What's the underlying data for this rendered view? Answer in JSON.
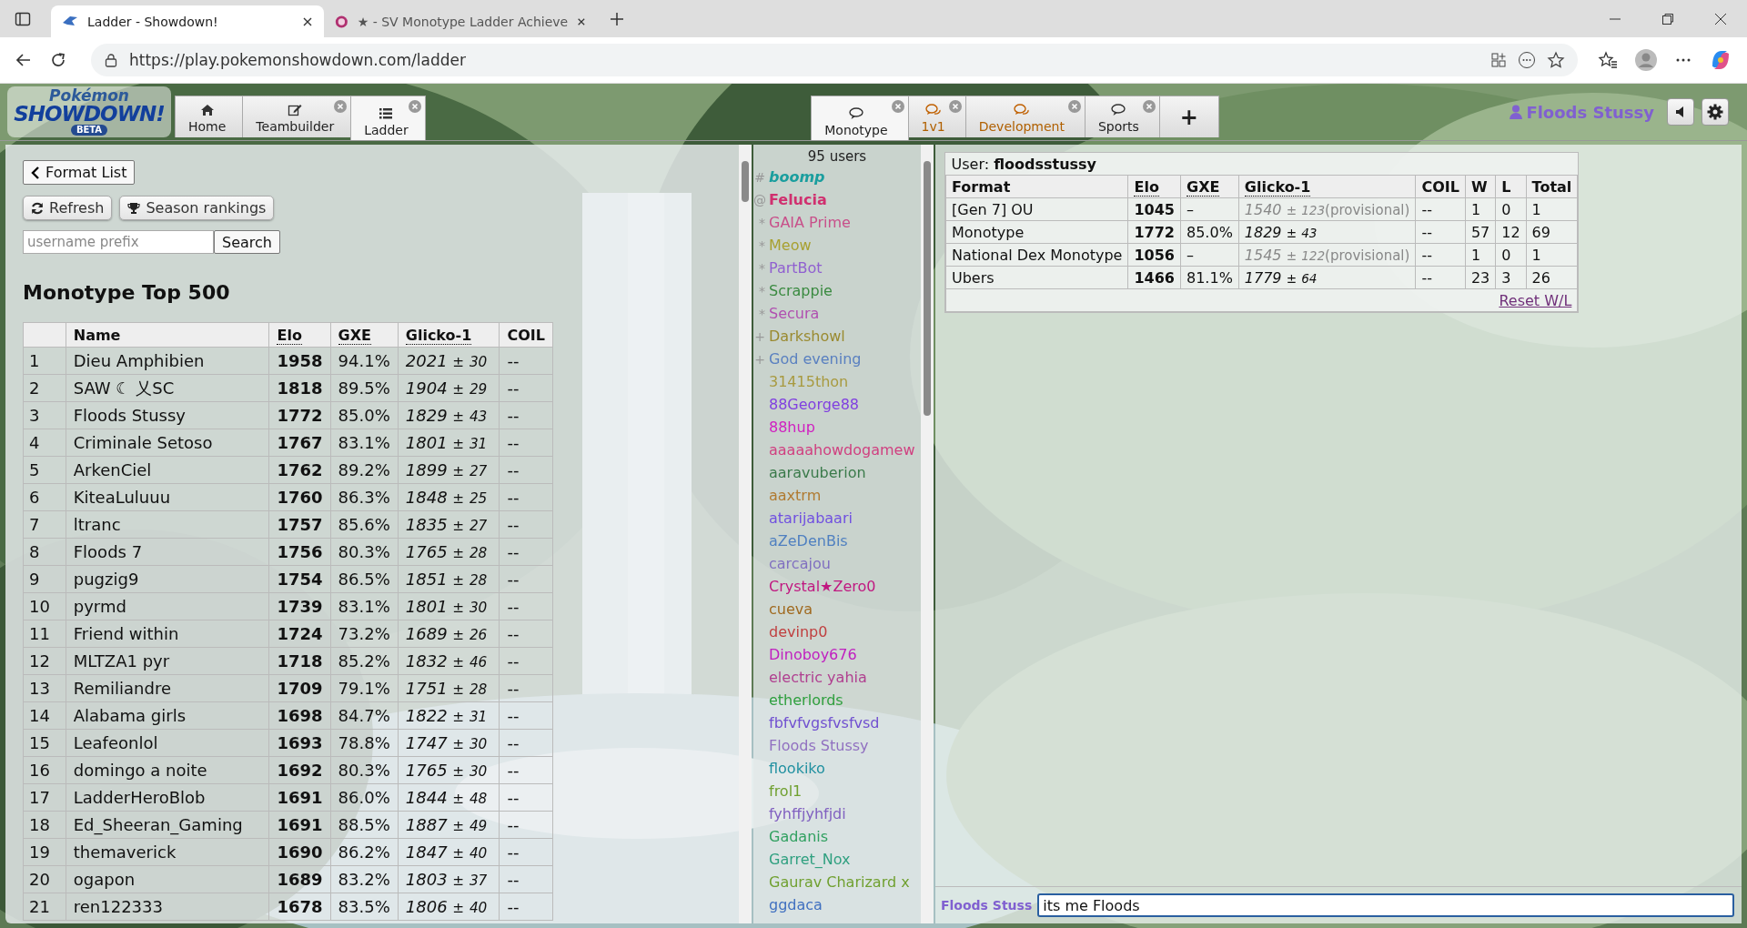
{
  "browser": {
    "tabs": [
      {
        "title": "Ladder - Showdown!",
        "selected": true
      },
      {
        "title": "★ - SV Monotype Ladder Achieve",
        "selected": false
      }
    ],
    "url": "https://play.pokemonshowdown.com/ladder"
  },
  "header": {
    "logo": {
      "top": "Pokémon",
      "main": "SHOWDOWN!",
      "badge": "BETA"
    },
    "nav_tabs": [
      {
        "label": "Home",
        "closable": false,
        "selected": false
      },
      {
        "label": "Teambuilder",
        "closable": true,
        "selected": false
      },
      {
        "label": "Ladder",
        "closable": true,
        "selected": true
      }
    ],
    "room_tabs": [
      {
        "label": "Monotype",
        "notifying": false,
        "selected": true
      },
      {
        "label": "1v1",
        "notifying": true,
        "selected": false
      },
      {
        "label": "Development",
        "notifying": true,
        "selected": false
      },
      {
        "label": "Sports",
        "notifying": false,
        "selected": false
      }
    ],
    "new_tab": "+",
    "username": "Floods Stussy"
  },
  "ladder": {
    "back_button": "Format List",
    "refresh_button": "Refresh",
    "season_button": "Season rankings",
    "search": {
      "placeholder": "username prefix"
    },
    "search_button": "Search",
    "heading": "Monotype Top 500",
    "columns": [
      {
        "label": "Name",
        "has_tooltip": false
      },
      {
        "label": "Elo",
        "has_tooltip": true
      },
      {
        "label": "GXE",
        "has_tooltip": true
      },
      {
        "label": "Glicko-1",
        "has_tooltip": true
      },
      {
        "label": "COIL",
        "has_tooltip": false
      }
    ],
    "rows": [
      {
        "rank": "1",
        "name": "Dieu Amphibien",
        "elo": "1958",
        "gxe": "94.1%",
        "rating": "2021",
        "pm": "±",
        "deviation": "30",
        "coil": "--"
      },
      {
        "rank": "2",
        "name": "SAW ☾ 乂SC",
        "elo": "1818",
        "gxe": "89.5%",
        "rating": "1904",
        "pm": "±",
        "deviation": "29",
        "coil": "--"
      },
      {
        "rank": "3",
        "name": "Floods Stussy",
        "elo": "1772",
        "gxe": "85.0%",
        "rating": "1829",
        "pm": "±",
        "deviation": "43",
        "coil": "--"
      },
      {
        "rank": "4",
        "name": "Criminale Setoso",
        "elo": "1767",
        "gxe": "83.1%",
        "rating": "1801",
        "pm": "±",
        "deviation": "31",
        "coil": "--"
      },
      {
        "rank": "5",
        "name": "ArkenCiel",
        "elo": "1762",
        "gxe": "89.2%",
        "rating": "1899",
        "pm": "±",
        "deviation": "27",
        "coil": "--"
      },
      {
        "rank": "6",
        "name": "KiteaLuluuu",
        "elo": "1760",
        "gxe": "86.3%",
        "rating": "1848",
        "pm": "±",
        "deviation": "25",
        "coil": "--"
      },
      {
        "rank": "7",
        "name": "ltranc",
        "elo": "1757",
        "gxe": "85.6%",
        "rating": "1835",
        "pm": "±",
        "deviation": "27",
        "coil": "--"
      },
      {
        "rank": "8",
        "name": "Floods 7",
        "elo": "1756",
        "gxe": "80.3%",
        "rating": "1765",
        "pm": "±",
        "deviation": "28",
        "coil": "--"
      },
      {
        "rank": "9",
        "name": "pugzig9",
        "elo": "1754",
        "gxe": "86.5%",
        "rating": "1851",
        "pm": "±",
        "deviation": "28",
        "coil": "--"
      },
      {
        "rank": "10",
        "name": "pyrmd",
        "elo": "1739",
        "gxe": "83.1%",
        "rating": "1801",
        "pm": "±",
        "deviation": "30",
        "coil": "--"
      },
      {
        "rank": "11",
        "name": "Friend within",
        "elo": "1724",
        "gxe": "73.2%",
        "rating": "1689",
        "pm": "±",
        "deviation": "26",
        "coil": "--"
      },
      {
        "rank": "12",
        "name": "MLTZA1 pyr",
        "elo": "1718",
        "gxe": "85.2%",
        "rating": "1832",
        "pm": "±",
        "deviation": "46",
        "coil": "--"
      },
      {
        "rank": "13",
        "name": "Remiliandre",
        "elo": "1709",
        "gxe": "79.1%",
        "rating": "1751",
        "pm": "±",
        "deviation": "28",
        "coil": "--"
      },
      {
        "rank": "14",
        "name": "Alabama girls",
        "elo": "1698",
        "gxe": "84.7%",
        "rating": "1822",
        "pm": "±",
        "deviation": "31",
        "coil": "--"
      },
      {
        "rank": "15",
        "name": "Leafeonlol",
        "elo": "1693",
        "gxe": "78.8%",
        "rating": "1747",
        "pm": "±",
        "deviation": "30",
        "coil": "--"
      },
      {
        "rank": "16",
        "name": "domingo a noite",
        "elo": "1692",
        "gxe": "80.3%",
        "rating": "1765",
        "pm": "±",
        "deviation": "30",
        "coil": "--"
      },
      {
        "rank": "17",
        "name": "LadderHeroBlob",
        "elo": "1691",
        "gxe": "86.0%",
        "rating": "1844",
        "pm": "±",
        "deviation": "48",
        "coil": "--"
      },
      {
        "rank": "18",
        "name": "Ed_Sheeran_Gaming",
        "elo": "1691",
        "gxe": "88.5%",
        "rating": "1887",
        "pm": "±",
        "deviation": "49",
        "coil": "--"
      },
      {
        "rank": "19",
        "name": "themaverick",
        "elo": "1690",
        "gxe": "86.2%",
        "rating": "1847",
        "pm": "±",
        "deviation": "40",
        "coil": "--"
      },
      {
        "rank": "20",
        "name": "ogapon",
        "elo": "1689",
        "gxe": "83.2%",
        "rating": "1803",
        "pm": "±",
        "deviation": "37",
        "coil": "--"
      },
      {
        "rank": "21",
        "name": "ren122333",
        "elo": "1678",
        "gxe": "83.5%",
        "rating": "1806",
        "pm": "±",
        "deviation": "40",
        "coil": "--"
      }
    ]
  },
  "userlist": {
    "count": "95 users",
    "users": [
      {
        "symbol": "#",
        "name": "boomp",
        "color": "#1a9e9e",
        "bold": true,
        "italic": true
      },
      {
        "symbol": "@",
        "name": "Felucia",
        "color": "#d0306f",
        "bold": true,
        "italic": false
      },
      {
        "symbol": "*",
        "name": "GAIA Prime",
        "color": "#c8508a",
        "bold": false,
        "italic": false
      },
      {
        "symbol": "*",
        "name": "Meow",
        "color": "#a8a030",
        "bold": false,
        "italic": false
      },
      {
        "symbol": "*",
        "name": "PartBot",
        "color": "#9060d0",
        "bold": false,
        "italic": false
      },
      {
        "symbol": "*",
        "name": "Scrappie",
        "color": "#3a8a40",
        "bold": false,
        "italic": false
      },
      {
        "symbol": "*",
        "name": "Secura",
        "color": "#b050b0",
        "bold": false,
        "italic": false
      },
      {
        "symbol": "+",
        "name": "Darkshowl",
        "color": "#9a8a30",
        "bold": false,
        "italic": false
      },
      {
        "symbol": "+",
        "name": "God evening",
        "color": "#5a80c0",
        "bold": false,
        "italic": false
      },
      {
        "name": "31415thon",
        "color": "#a89a40",
        "bold": false,
        "italic": false
      },
      {
        "name": "88George88",
        "color": "#8040e0",
        "bold": false,
        "italic": false
      },
      {
        "name": "88hup",
        "color": "#d020c0",
        "bold": false,
        "italic": false
      },
      {
        "name": "aaaaahowdogamew",
        "color": "#d04080",
        "bold": false,
        "italic": false
      },
      {
        "name": "aaravuberion",
        "color": "#3a7a4a",
        "bold": false,
        "italic": false
      },
      {
        "name": "aaxtrm",
        "color": "#b07a30",
        "bold": false,
        "italic": false
      },
      {
        "name": "atarijabaari",
        "color": "#7050e0",
        "bold": false,
        "italic": false
      },
      {
        "name": "aZeDenBis",
        "color": "#5080c0",
        "bold": false,
        "italic": false
      },
      {
        "name": "carcajou",
        "color": "#8070c0",
        "bold": false,
        "italic": false
      },
      {
        "name": "Crystal★Zero0",
        "color": "#c01880",
        "bold": false,
        "italic": false
      },
      {
        "name": "cueva",
        "color": "#a06a20",
        "bold": false,
        "italic": false
      },
      {
        "name": "devinp0",
        "color": "#c04040",
        "bold": false,
        "italic": false
      },
      {
        "name": "Dinoboy676",
        "color": "#c020c0",
        "bold": false,
        "italic": false
      },
      {
        "name": "electric yahia",
        "color": "#b04090",
        "bold": false,
        "italic": false
      },
      {
        "name": "etherlords",
        "color": "#30a040",
        "bold": false,
        "italic": false
      },
      {
        "name": "fbfvfvgsfvsfvsd",
        "color": "#7050d0",
        "bold": false,
        "italic": false
      },
      {
        "name": "Floods Stussy",
        "color": "#9070c0",
        "bold": false,
        "italic": false
      },
      {
        "name": "flookiko",
        "color": "#2090a0",
        "bold": false,
        "italic": false
      },
      {
        "name": "frol1",
        "color": "#70a030",
        "bold": false,
        "italic": false
      },
      {
        "name": "fyhffjyhfjdi",
        "color": "#8060c0",
        "bold": false,
        "italic": false
      },
      {
        "name": "Gadanis",
        "color": "#30a060",
        "bold": false,
        "italic": false
      },
      {
        "name": "Garret_Nox",
        "color": "#30a080",
        "bold": false,
        "italic": false
      },
      {
        "name": "Gaurav Charizard x",
        "color": "#70a030",
        "bold": false,
        "italic": false
      },
      {
        "name": "ggdaca",
        "color": "#4070c0",
        "bold": false,
        "italic": false
      }
    ]
  },
  "user_panel": {
    "label": "User:",
    "username": "floodsstussy",
    "columns": [
      {
        "label": "Format",
        "has_tooltip": false
      },
      {
        "label": "Elo",
        "has_tooltip": true
      },
      {
        "label": "GXE",
        "has_tooltip": true
      },
      {
        "label": "Glicko-1",
        "has_tooltip": true
      },
      {
        "label": "COIL",
        "has_tooltip": false
      },
      {
        "label": "W",
        "has_tooltip": false
      },
      {
        "label": "L",
        "has_tooltip": false
      },
      {
        "label": "Total",
        "has_tooltip": false
      }
    ],
    "rows": [
      {
        "format": "[Gen 7] OU",
        "elo": "1045",
        "gxe": "–",
        "rating": "1540",
        "pm": "±",
        "deviation": "123",
        "provisional": true,
        "note": "(provisional)",
        "coil": "--",
        "w": "1",
        "l": "0",
        "total": "1"
      },
      {
        "format": "Monotype",
        "elo": "1772",
        "gxe": "85.0%",
        "rating": "1829",
        "pm": "±",
        "deviation": "43",
        "provisional": false,
        "coil": "--",
        "w": "57",
        "l": "12",
        "total": "69"
      },
      {
        "format": "National Dex Monotype",
        "elo": "1056",
        "gxe": "–",
        "rating": "1545",
        "pm": "±",
        "deviation": "122",
        "provisional": true,
        "note": "(provisional)",
        "coil": "--",
        "w": "1",
        "l": "0",
        "total": "1"
      },
      {
        "format": "Ubers",
        "elo": "1466",
        "gxe": "81.1%",
        "rating": "1779",
        "pm": "±",
        "deviation": "64",
        "provisional": false,
        "coil": "--",
        "w": "23",
        "l": "3",
        "total": "26"
      }
    ],
    "reset_link": "Reset W/L"
  },
  "chat": {
    "name": "Floods Stuss",
    "message": "its me Floods"
  }
}
